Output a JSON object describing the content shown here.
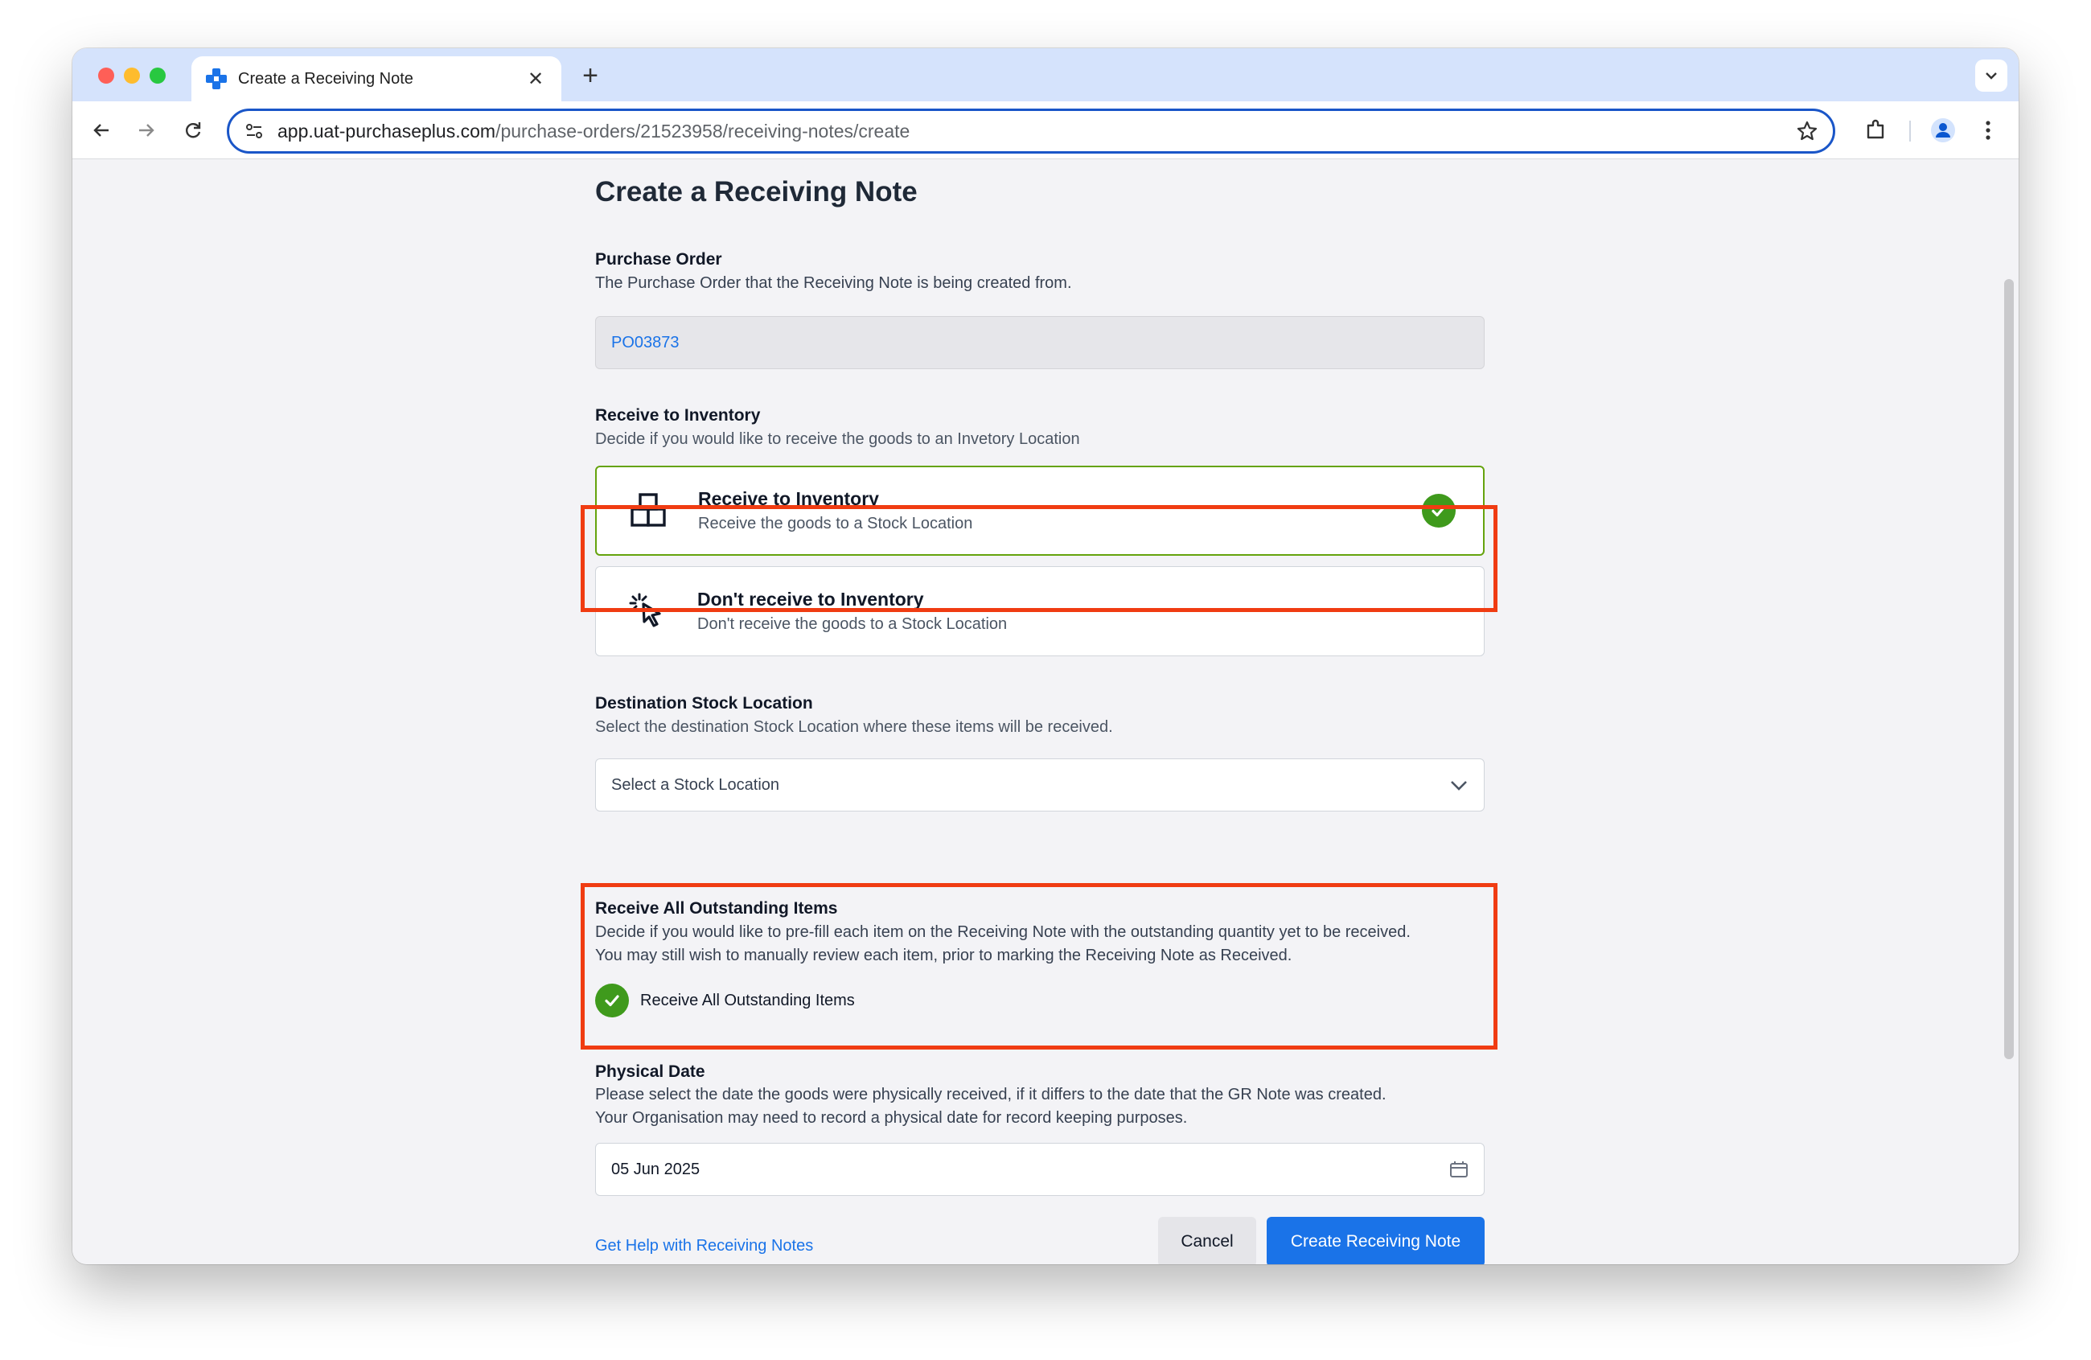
{
  "browser": {
    "tab_title": "Create a Receiving Note",
    "new_tab_symbol": "+",
    "close_symbol": "✕",
    "url_host": "app.uat-purchaseplus.com",
    "url_path": "/purchase-orders/21523958/receiving-notes/create"
  },
  "page": {
    "title": "Create a Receiving Note",
    "purchase_order": {
      "label": "Purchase Order",
      "description": "The Purchase Order that the Receiving Note is being created from.",
      "value": "PO03873"
    },
    "receive_to_inventory": {
      "label": "Receive to Inventory",
      "description": "Decide if you would like to receive the goods to an Invetory Location",
      "options": [
        {
          "title": "Receive to Inventory",
          "subtitle": "Receive the goods to a Stock Location",
          "icon": "boxes-icon",
          "selected": true
        },
        {
          "title": "Don't receive to Inventory",
          "subtitle": "Don't receive the goods to a Stock Location",
          "icon": "cursor-click-icon",
          "selected": false
        }
      ]
    },
    "destination": {
      "label": "Destination Stock Location",
      "description": "Select the destination Stock Location where these items will be received.",
      "placeholder": "Select a Stock Location"
    },
    "receive_all": {
      "label": "Receive All Outstanding Items",
      "description_line1": "Decide if you would like to pre-fill each item on the Receiving Note with the outstanding quantity yet to be received.",
      "description_line2": "You may still wish to manually review each item, prior to marking the Receiving Note as Received.",
      "checkbox_label": "Receive All Outstanding Items",
      "checked": true
    },
    "physical_date": {
      "label": "Physical Date",
      "description_line1": "Please select the date the goods were physically received, if it differs to the date that the GR Note was created.",
      "description_line2": "Your Organisation may need to record a physical date for record keeping purposes.",
      "value": "05 Jun 2025"
    },
    "footer": {
      "help_link": "Get Help with Receiving Notes",
      "cancel_label": "Cancel",
      "create_label": "Create Receiving Note"
    }
  },
  "colors": {
    "accent": "#1a73e8",
    "success": "#3f9a1c",
    "highlight": "#f03c12"
  }
}
